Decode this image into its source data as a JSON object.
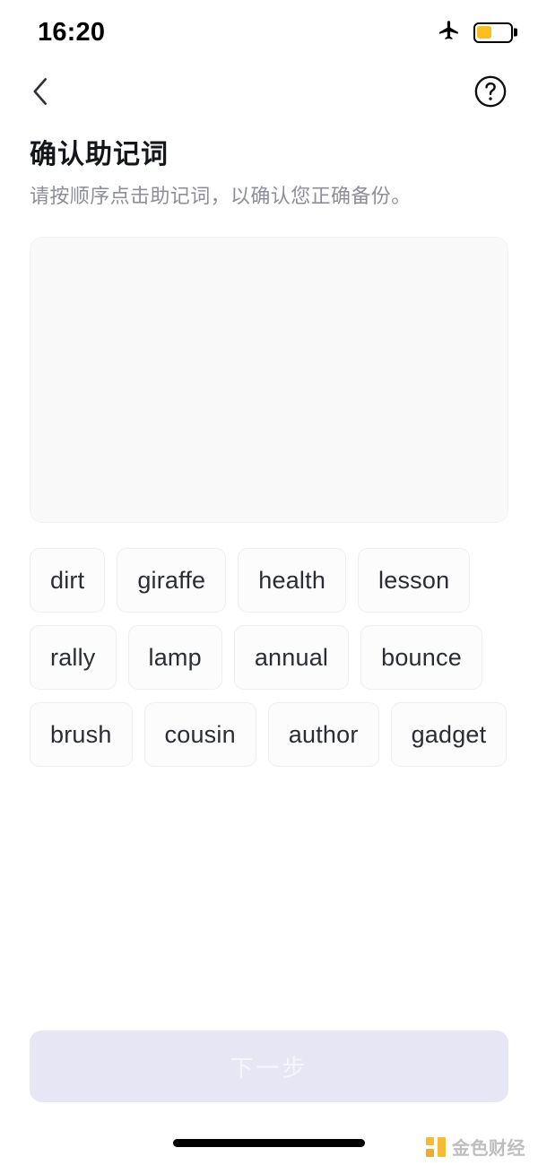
{
  "status_bar": {
    "time": "16:20",
    "airplane_icon": "airplane-mode-icon",
    "battery_icon": "battery-low-power-icon",
    "battery_level_percent": 45,
    "battery_color": "#FDBF20"
  },
  "nav": {
    "back_icon": "chevron-left-icon",
    "help_icon": "question-mark-circle-icon"
  },
  "header": {
    "title": "确认助记词",
    "subtitle": "请按顺序点击助记词，以确认您正确备份。"
  },
  "answer_area": {
    "name": "selected-words-area",
    "selected_words": [],
    "background_color": "#f9f9fa"
  },
  "word_bank": {
    "words": [
      "dirt",
      "giraffe",
      "health",
      "lesson",
      "rally",
      "lamp",
      "annual",
      "bounce",
      "brush",
      "cousin",
      "author",
      "gadget"
    ]
  },
  "footer": {
    "next_label": "下一步",
    "next_disabled": true,
    "next_background": "#e7e6f4",
    "next_text_color": "#f6f5fb"
  },
  "watermark": {
    "text": "金色财经",
    "logo_icon": "jinse-logo-icon",
    "logo_color": "#F5B623"
  },
  "home_indicator": {
    "name": "home-indicator"
  }
}
